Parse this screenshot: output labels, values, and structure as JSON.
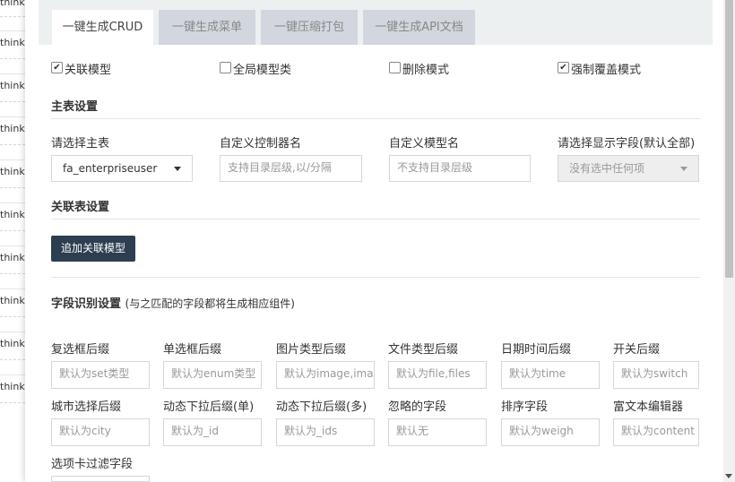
{
  "background": {
    "items": [
      "think",
      "think",
      "think",
      "think",
      "think",
      "think",
      "think",
      "think",
      "think",
      "think"
    ]
  },
  "tabs": [
    {
      "label": "一键生成CRUD",
      "active": true
    },
    {
      "label": "一键生成菜单",
      "active": false
    },
    {
      "label": "一键压缩打包",
      "active": false
    },
    {
      "label": "一键生成API文档",
      "active": false
    }
  ],
  "options": [
    {
      "label": "关联模型",
      "checked": true
    },
    {
      "label": "全局模型类",
      "checked": false
    },
    {
      "label": "删除模式",
      "checked": false
    },
    {
      "label": "强制覆盖模式",
      "checked": true
    }
  ],
  "main_settings": {
    "title": "主表设置",
    "table_label": "请选择主表",
    "table_value": "fa_enterpriseuser",
    "controller_label": "自定义控制器名",
    "controller_placeholder": "支持目录层级,以/分隔",
    "model_label": "自定义模型名",
    "model_placeholder": "不支持目录层级",
    "fields_label": "请选择显示字段(默认全部)",
    "fields_placeholder": "没有选中任何项"
  },
  "relation_settings": {
    "title": "关联表设置",
    "add_button": "追加关联模型"
  },
  "field_settings": {
    "title": "字段识别设置",
    "subtitle": "(与之匹配的字段都将生成相应组件)",
    "fields": [
      {
        "label": "复选框后缀",
        "placeholder": "默认为set类型"
      },
      {
        "label": "单选框后缀",
        "placeholder": "默认为enum类型"
      },
      {
        "label": "图片类型后缀",
        "placeholder": "默认为image,images"
      },
      {
        "label": "文件类型后缀",
        "placeholder": "默认为file,files"
      },
      {
        "label": "日期时间后缀",
        "placeholder": "默认为time"
      },
      {
        "label": "开关后缀",
        "placeholder": "默认为switch"
      },
      {
        "label": "城市选择后缀",
        "placeholder": "默认为city"
      },
      {
        "label": "动态下拉后缀(单)",
        "placeholder": "默认为_id"
      },
      {
        "label": "动态下拉后缀(多)",
        "placeholder": "默认为_ids"
      },
      {
        "label": "忽略的字段",
        "placeholder": "默认无"
      },
      {
        "label": "排序字段",
        "placeholder": "默认为weigh"
      },
      {
        "label": "富文本编辑器",
        "placeholder": "默认为content"
      },
      {
        "label": "选项卡过滤字段",
        "placeholder": ""
      }
    ]
  },
  "colors": {
    "tab_bar_bg": "#ecf0f1",
    "tab_inactive_bg": "#d2d6de",
    "button_dark": "#2c3e50"
  }
}
